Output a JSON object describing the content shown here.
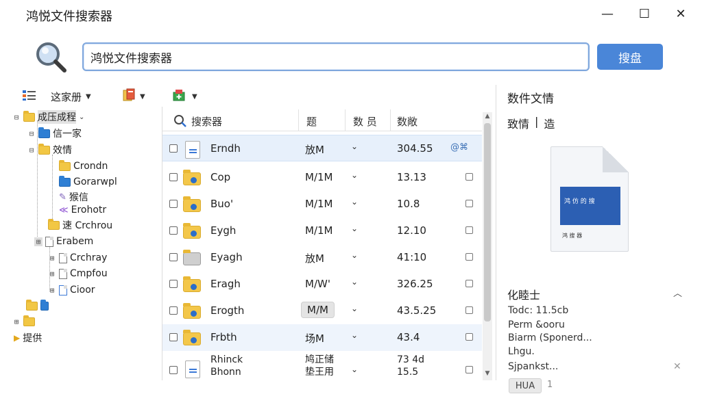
{
  "app": {
    "title": "鸿悦文件搜索器"
  },
  "window_controls": {
    "minimize": "—",
    "maximize": "☐",
    "close": "✕"
  },
  "search": {
    "value": "鸿悦文件搜索器",
    "button_label": "搜盘"
  },
  "toolbar": {
    "view_label": "这家册"
  },
  "tree": [
    {
      "label": "成压成程",
      "expander": "⊟",
      "icon": "folder",
      "selected": true
    },
    {
      "label": "信一家",
      "expander": "⊟",
      "icon": "folder-blue"
    },
    {
      "label": "效情",
      "expander": "⊟",
      "icon": "folder"
    },
    {
      "label": "Crondn",
      "expander": "",
      "icon": "folder"
    },
    {
      "label": "Gorarwpl",
      "expander": "",
      "icon": "folder-blue"
    },
    {
      "label": "猴信",
      "expander": "",
      "icon": "tag"
    },
    {
      "label": "Erohotr",
      "expander": "",
      "icon": "audio"
    },
    {
      "label": "速 Crchrou",
      "expander": "",
      "icon": "folder"
    },
    {
      "label": "Erabem",
      "expander": "⊞",
      "icon": "doc"
    },
    {
      "label": "Crchray",
      "expander": "⊞",
      "icon": "doc"
    },
    {
      "label": "Cmpfou",
      "expander": "⊞",
      "icon": "doc"
    },
    {
      "label": "Cioor",
      "expander": "⊞",
      "icon": "doc"
    },
    {
      "label": "",
      "expander": "",
      "icon": "folder"
    },
    {
      "label": "",
      "expander": "⊞",
      "icon": "folder"
    },
    {
      "label": "提供",
      "expander": "",
      "icon": "arrow"
    }
  ],
  "list": {
    "headers": {
      "name": "搜索器",
      "type": "题",
      "count": "数 员",
      "size": "数敞"
    },
    "rows": [
      {
        "name": "Erndh",
        "type": "放M",
        "size": "304.55",
        "icon": "doc",
        "extra": "@⌘"
      },
      {
        "name": "Cop",
        "type": "M/1M",
        "size": "13.13",
        "icon": "folder"
      },
      {
        "name": "Buo'",
        "type": "M/1M",
        "size": "10.8",
        "icon": "folder"
      },
      {
        "name": "Eygh",
        "type": "M/1M",
        "size": "12.10",
        "icon": "folder"
      },
      {
        "name": "Eyagh",
        "type": "放M",
        "size": "41:10",
        "icon": "folder-gray"
      },
      {
        "name": "Eragh",
        "type": "M/W'",
        "size": "326.25",
        "icon": "folder"
      },
      {
        "name": "Erogth",
        "type": "M/M",
        "size": "43.5.25",
        "icon": "folder"
      },
      {
        "name": "Frbth",
        "type": "场M",
        "size": "43.4",
        "icon": "folder"
      },
      {
        "name": "Rhinck Bhonn",
        "type": "鸠正储 垫王用",
        "size": "73 4d 15.5",
        "icon": "doc"
      }
    ]
  },
  "preview": {
    "title": "数件文情",
    "tabs": [
      "致情",
      "|",
      "造"
    ],
    "doc_image_text": "鸿 仿 的 搜",
    "doc_caption": "鸿 搜 器"
  },
  "properties": {
    "title": "化睦士",
    "items": [
      "Todc: 11.5cb",
      "Perm &ooru",
      "Biarm (Sponerd...",
      "Lhgu.",
      "Sjpankst..."
    ],
    "chip": "HUA",
    "chip2": "1"
  }
}
